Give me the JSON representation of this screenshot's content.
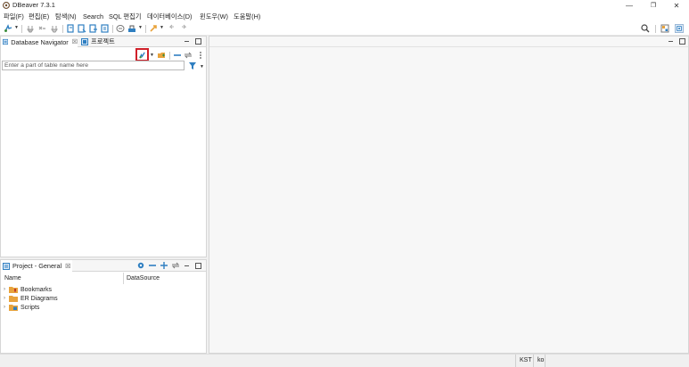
{
  "window": {
    "title": "DBeaver 7.3.1",
    "minimize": "—",
    "maximize": "❐",
    "close": "✕"
  },
  "menu": [
    "파일(F)",
    "편집(E)",
    "탐색(N)",
    "Search",
    "SQL 편집기",
    "데이터베이스(D)",
    "윈도우(W)",
    "도움말(H)"
  ],
  "navigator": {
    "tab_label": "Database Navigator",
    "tab_close": "☒",
    "projects_tab_label": "프로젝트",
    "search_placeholder": "Enter a part of table name here"
  },
  "project_panel": {
    "title": "Project - General",
    "tab_close": "☒",
    "columns": [
      "Name",
      "DataSource"
    ],
    "items": [
      {
        "label": "Bookmarks",
        "icon": "bookmarks-folder-icon"
      },
      {
        "label": "ER Diagrams",
        "icon": "folder-icon"
      },
      {
        "label": "Scripts",
        "icon": "scripts-folder-icon"
      }
    ]
  },
  "status": {
    "timezone": "KST",
    "locale": "ko"
  },
  "colors": {
    "highlight_border": "#d0202a",
    "accent_blue": "#2f7fc1",
    "folder_orange": "#e8a33c"
  }
}
